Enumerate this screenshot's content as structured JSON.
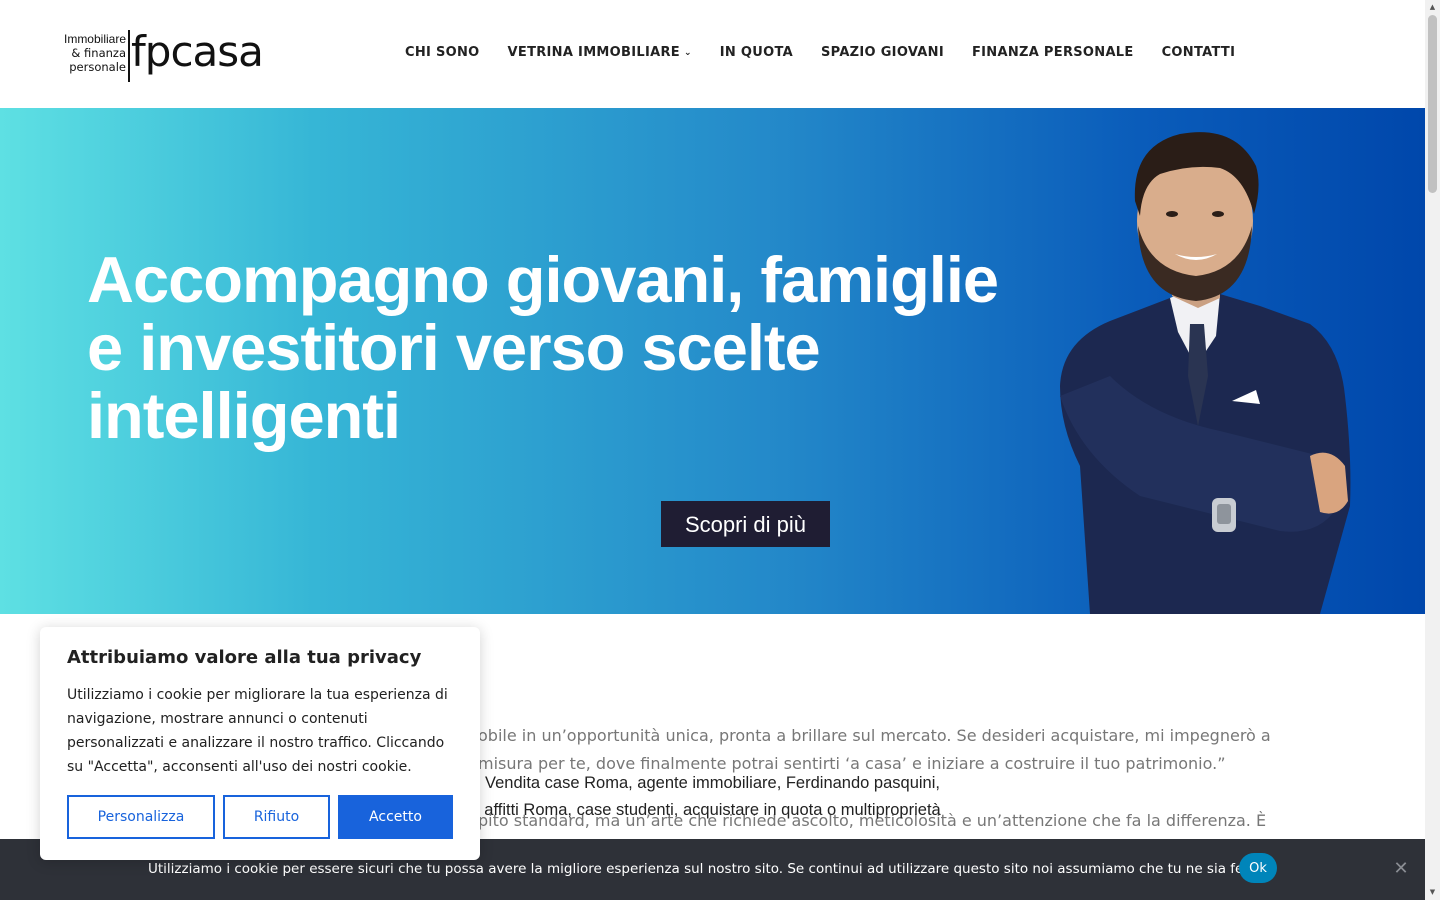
{
  "logo": {
    "line1": "Immobiliare",
    "line2": "& finanza",
    "line3": "personale",
    "brand": "fpcasa"
  },
  "nav": {
    "items": [
      {
        "label": "CHI SONO"
      },
      {
        "label": "VETRINA IMMOBILIARE",
        "has_dropdown": true
      },
      {
        "label": "IN QUOTA"
      },
      {
        "label": "SPAZIO GIOVANI"
      },
      {
        "label": "FINANZA PERSONALE"
      },
      {
        "label": "CONTATTI"
      }
    ]
  },
  "hero": {
    "title": "Accompagno giovani, famiglie e investitori verso scelte intelligenti",
    "cta_label": "Scopri di più",
    "image_alt": "Vendita case Roma, agente immobiliare, Ferdinando pasquini, affitti Roma, case studenti, acquistare in quota o multiproprietà",
    "gradient_colors": [
      "#5ee0e3",
      "#0047ab"
    ]
  },
  "content": {
    "line1": "obile in un’opportunità unica, pronta a brillare sul mercato. Se desideri acquistare, mi impegnerò a",
    "line2": "misura per te, dove finalmente potrai sentirti ‘a casa’ e iniziare a costruire il tuo patrimonio.”",
    "line3": "pito standard, ma un’arte che richiede ascolto, meticolosità e un’attenzione che fa la differenza. È"
  },
  "privacy_modal": {
    "title": "Attribuiamo valore alla tua privacy",
    "body": "Utilizziamo i cookie per migliorare la tua esperienza di navigazione, mostrare annunci o contenuti personalizzati e analizzare il nostro traffico. Cliccando su \"Accetta\", acconsenti all'uso dei nostri cookie.",
    "customize_label": "Personalizza",
    "reject_label": "Rifiuto",
    "accept_label": "Accetto",
    "accent_color": "#1863dc"
  },
  "cookie_bar": {
    "text": "Utilizziamo i cookie per essere sicuri che tu possa avere la migliore esperienza sul nostro sito. Se continui ad utilizzare questo sito noi assumiamo che tu ne sia felice.",
    "ok_label": "Ok",
    "close_icon": "close-icon",
    "background": "#2e3138",
    "ok_color": "#0085ba"
  }
}
